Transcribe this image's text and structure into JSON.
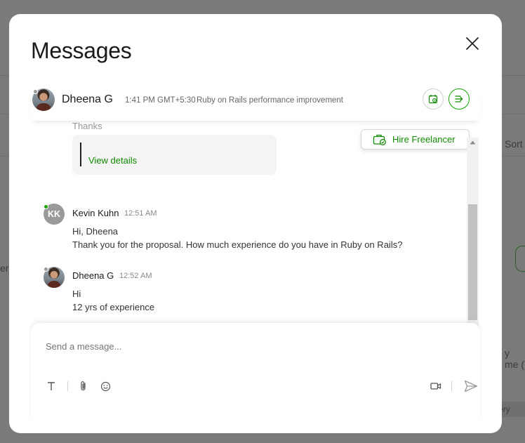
{
  "background": {
    "fragments": {
      "sort": "Sort",
      "me": "y me (",
      "er": "er",
      "ery": "ery"
    }
  },
  "modal": {
    "title": "Messages",
    "close_icon": "close-icon"
  },
  "thread_header": {
    "name": "Dheena G",
    "time": "1:41 PM GMT+5:30",
    "topic": "Ruby on Rails performance improvement",
    "presence_color": "#9a9a9a",
    "actions": [
      {
        "icon": "calendar-clock-icon"
      },
      {
        "icon": "collapse-panel-icon"
      }
    ]
  },
  "conversation": {
    "faded_text": "Thanks",
    "card_link": "View details",
    "hire_button": {
      "label": "Hire Freelancer",
      "icon": "briefcase-check-icon"
    },
    "messages": [
      {
        "sender": "Kevin Kuhn",
        "initials": "KK",
        "time": "12:51 AM",
        "presence_color": "#14a800",
        "lines": [
          "Hi, Dheena",
          "Thank you for the proposal. How much experience do you have in Ruby on Rails?"
        ]
      },
      {
        "sender": "Dheena G",
        "time": "12:52 AM",
        "presence_color": "#9a9a9a",
        "lines": [
          "Hi",
          "12 yrs of experience"
        ]
      }
    ]
  },
  "composer": {
    "placeholder": "Send a message...",
    "tools_left": [
      "text-format-icon",
      "paperclip-icon",
      "emoji-icon"
    ],
    "tools_right": [
      "video-icon",
      "send-icon"
    ]
  },
  "colors": {
    "accent": "#14a800",
    "link": "#108a00"
  }
}
